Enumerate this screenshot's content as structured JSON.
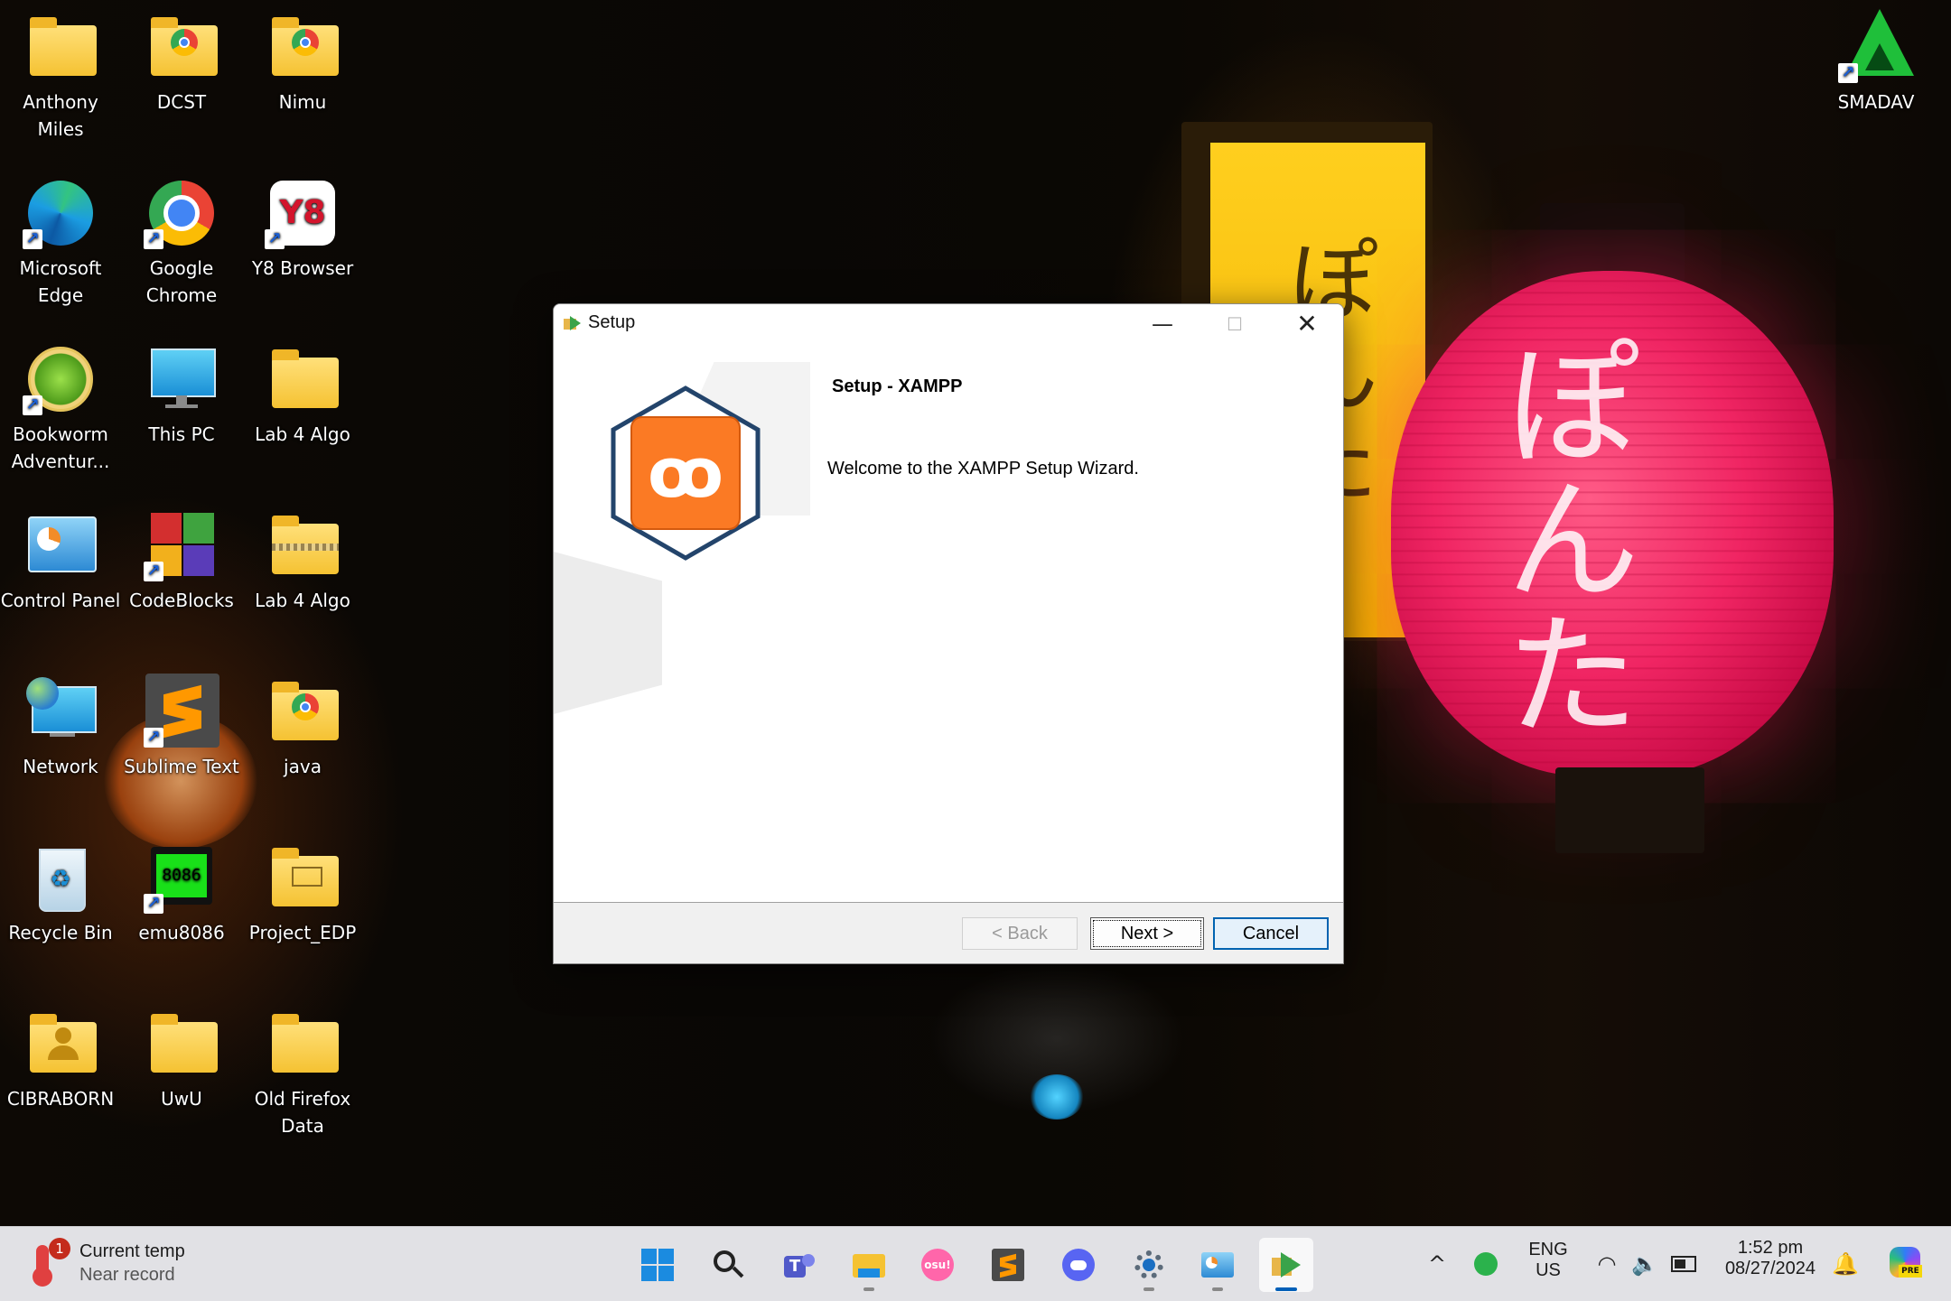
{
  "desktop": {
    "icons": [
      {
        "label": "Anthony Miles"
      },
      {
        "label": "DCST"
      },
      {
        "label": "Nimu"
      },
      {
        "label": "Microsoft Edge"
      },
      {
        "label": "Google Chrome"
      },
      {
        "label": "Y8 Browser"
      },
      {
        "label": "Bookworm Adventur..."
      },
      {
        "label": "This PC"
      },
      {
        "label": "Lab 4 Algo"
      },
      {
        "label": "Control Panel"
      },
      {
        "label": "CodeBlocks"
      },
      {
        "label": "Lab 4 Algo"
      },
      {
        "label": "Network"
      },
      {
        "label": "Sublime Text"
      },
      {
        "label": "java"
      },
      {
        "label": "Recycle Bin"
      },
      {
        "label": "emu8086"
      },
      {
        "label": "Project_EDP"
      },
      {
        "label": "CIBRABORN"
      },
      {
        "label": "UwU"
      },
      {
        "label": "Old Firefox Data"
      },
      {
        "label": "SMADAV"
      }
    ],
    "emu_chip_text": "8086",
    "y8_text": "Y8"
  },
  "window": {
    "title": "Setup",
    "heading": "Setup - XAMPP",
    "welcome": "Welcome to the XAMPP Setup Wizard.",
    "buttons": {
      "back": "< Back",
      "next": "Next >",
      "cancel": "Cancel"
    },
    "minimize_glyph": "—",
    "maximize_glyph": "☐",
    "close_glyph": "✕"
  },
  "taskbar": {
    "weather": {
      "line1": "Current temp",
      "line2": "Near record",
      "badge": "1"
    },
    "apps": [
      "start",
      "search",
      "teams",
      "file-explorer",
      "osu",
      "sublime-text",
      "discord",
      "settings",
      "control-panel",
      "setup"
    ],
    "osu_text": "osu!",
    "lang_line1": "ENG",
    "lang_line2": "US",
    "time": "1:52 pm",
    "date": "08/27/2024",
    "copilot_badge": "PRE"
  },
  "colors": {
    "xampp_orange": "#fb7a24",
    "xampp_navy": "#23446b",
    "accent_blue": "#0063b1",
    "folder_yellow": "#f5c232"
  }
}
